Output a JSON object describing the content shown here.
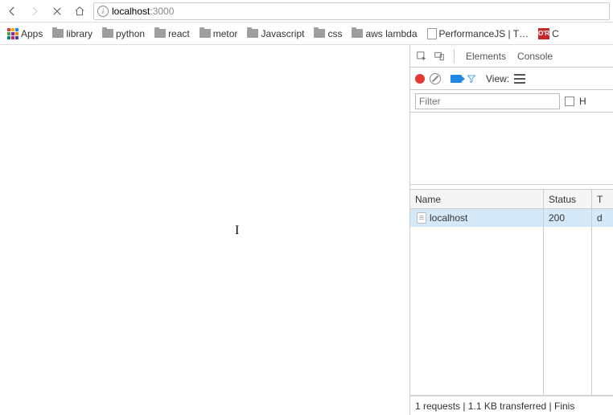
{
  "nav": {
    "url_host": "localhost",
    "url_port": ":3000"
  },
  "bookmarks": {
    "apps_label": "Apps",
    "items": [
      {
        "label": "library",
        "kind": "folder"
      },
      {
        "label": "python",
        "kind": "folder"
      },
      {
        "label": "react",
        "kind": "folder"
      },
      {
        "label": "metor",
        "kind": "folder"
      },
      {
        "label": "Javascript",
        "kind": "folder"
      },
      {
        "label": "css",
        "kind": "folder"
      },
      {
        "label": "aws lambda",
        "kind": "folder"
      },
      {
        "label": "PerformanceJS | T…",
        "kind": "page"
      }
    ],
    "oreilly_label": "O'R"
  },
  "devtools": {
    "tabs": {
      "elements": "Elements",
      "console": "Console"
    },
    "toolbar": {
      "view_label": "View:"
    },
    "filter": {
      "placeholder": "Filter",
      "hide_label_initial": "H"
    },
    "table": {
      "headers": {
        "name": "Name",
        "status": "Status",
        "type": "T"
      },
      "rows": [
        {
          "name": "localhost",
          "status": "200",
          "type": "d"
        }
      ]
    },
    "status_text": "1 requests | 1.1 KB transferred | Finis"
  }
}
